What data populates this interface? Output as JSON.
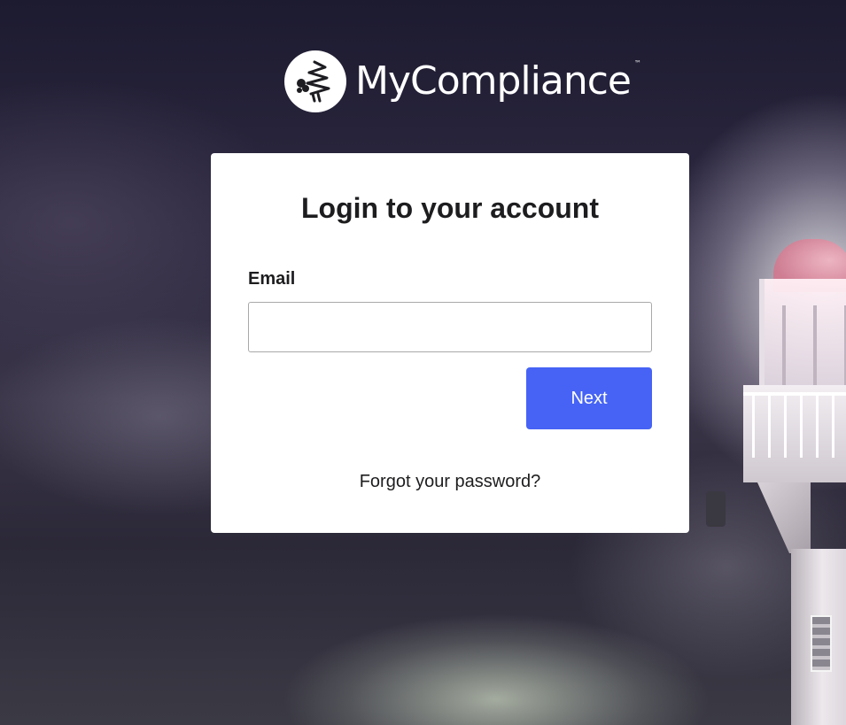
{
  "brand": {
    "name": "MyCompliance",
    "trademark": "™",
    "logo_icon": "lighthouse-logo-icon"
  },
  "login": {
    "title": "Login to your account",
    "email_label": "Email",
    "email_value": "",
    "email_placeholder": "",
    "next_label": "Next",
    "forgot_password_label": "Forgot your password?"
  },
  "colors": {
    "accent": "#4663f5",
    "card_background": "#ffffff",
    "text": "#1d1d1f"
  }
}
